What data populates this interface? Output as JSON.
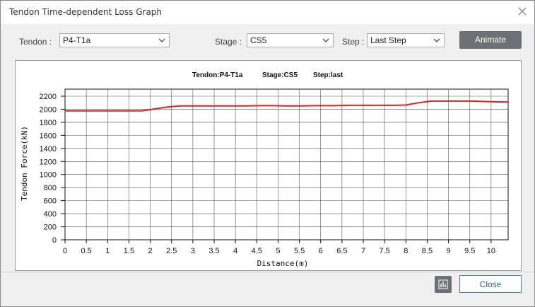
{
  "window": {
    "title": "Tendon Time-dependent Loss Graph"
  },
  "icons": {
    "close": "close-icon",
    "chart": "bar-chart-icon",
    "dropdown": "chevron-down-icon"
  },
  "controls": {
    "tendon_label": "Tendon :",
    "tendon_value": "P4-T1a",
    "stage_label": "Stage :",
    "stage_value": "CS5",
    "step_label": "Step :",
    "step_value": "Last Step",
    "animate_label": "Animate"
  },
  "footer": {
    "close_label": "Close"
  },
  "chart_data": {
    "type": "line",
    "header": {
      "tendon": "Tendon:P4-T1a",
      "stage": "Stage:CS5",
      "step": "Step:last"
    },
    "xlabel": "Distance(m)",
    "ylabel": "Tendon Force(kN)",
    "xlim": [
      0,
      10.4
    ],
    "ylim": [
      0,
      2200
    ],
    "x_ticks": [
      "0",
      "0.5",
      "1",
      "1.5",
      "2",
      "2.5",
      "3",
      "3.5",
      "4",
      "4.5",
      "5",
      "5.5",
      "6",
      "6.5",
      "7",
      "7.5",
      "8",
      "8.5",
      "9",
      "9.5",
      "10"
    ],
    "y_ticks": [
      "0",
      "200",
      "400",
      "600",
      "800",
      "1000",
      "1200",
      "1400",
      "1600",
      "1800",
      "2000",
      "2200"
    ],
    "grid": true,
    "series": [
      {
        "color": "#e02020",
        "x": [
          0,
          0.6,
          1.2,
          1.8,
          2.1,
          2.4,
          2.7,
          3.2,
          3.7,
          4.2,
          4.6,
          4.9,
          5.2,
          5.5,
          5.9,
          6.3,
          6.7,
          7.2,
          7.7,
          8.0,
          8.3,
          8.6,
          9.0,
          9.5,
          10.0,
          10.4
        ],
        "y": [
          1975,
          1975,
          1975,
          1975,
          2005,
          2035,
          2050,
          2050,
          2050,
          2050,
          2055,
          2055,
          2050,
          2050,
          2055,
          2055,
          2060,
          2060,
          2060,
          2065,
          2100,
          2125,
          2125,
          2125,
          2115,
          2110
        ]
      }
    ]
  }
}
